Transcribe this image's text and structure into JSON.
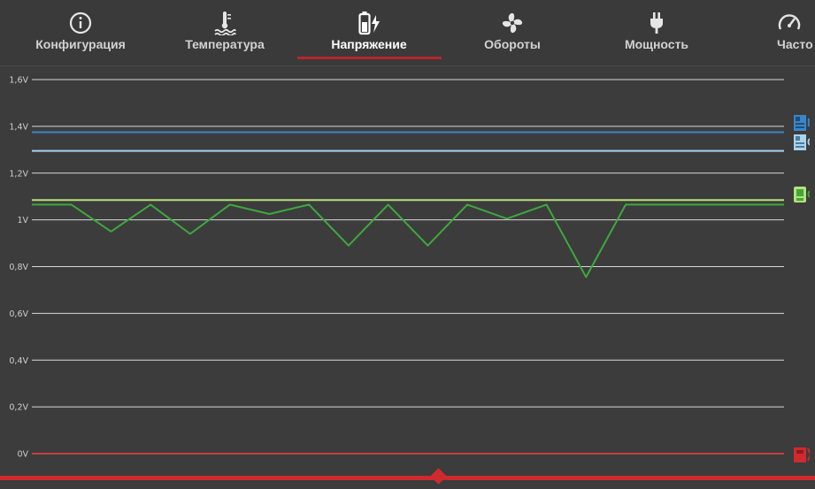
{
  "tabs": [
    {
      "label": "Конфигурация",
      "icon": "info-icon"
    },
    {
      "label": "Температура",
      "icon": "thermometer-icon"
    },
    {
      "label": "Напряжение",
      "icon": "battery-bolt-icon",
      "active": true
    },
    {
      "label": "Обороты",
      "icon": "fan-icon"
    },
    {
      "label": "Мощность",
      "icon": "plug-icon"
    },
    {
      "label": "Часто",
      "icon": "gauge-icon"
    }
  ],
  "legend_labels": {
    "blue_1": "D",
    "blue_2": "C",
    "green_1": "G"
  },
  "colors": {
    "background": "#3c3c3c",
    "grid": "#d8d8d8",
    "accent_red": "#cf2a2e",
    "series_blue": "#3a86c8",
    "series_lightblue": "#a9d3ef",
    "series_lightgreen": "#b6e07a",
    "series_green": "#3ea83e",
    "series_red": "#c94040"
  },
  "chart_data": {
    "type": "line",
    "yticks": [
      "1,6V",
      "1,4V",
      "1,2V",
      "1V",
      "0,8V",
      "0,6V",
      "0,4V",
      "0,2V",
      "0V"
    ],
    "ylim": [
      0,
      1.6
    ],
    "grid": true,
    "series": [
      {
        "color": "#3a86c8",
        "values": [
          1.375,
          1.375
        ]
      },
      {
        "color": "#a9d3ef",
        "values": [
          1.295,
          1.295
        ]
      },
      {
        "color": "#b6e07a",
        "values": [
          1.085,
          1.085,
          1.085,
          1.085,
          1.085,
          1.085,
          1.085,
          1.085,
          1.085,
          1.085,
          1.085,
          1.085,
          1.085,
          1.085,
          1.085,
          1.085,
          1.085,
          1.085,
          1.085,
          1.085
        ]
      },
      {
        "color": "#3ea83e",
        "values": [
          1.065,
          1.065,
          0.95,
          1.065,
          0.94,
          1.065,
          1.025,
          1.065,
          0.89,
          1.065,
          0.89,
          1.065,
          1.005,
          1.065,
          0.755,
          1.065,
          1.065,
          1.065,
          1.065,
          1.065
        ]
      },
      {
        "color": "#c94040",
        "values": [
          0,
          0
        ]
      }
    ]
  }
}
